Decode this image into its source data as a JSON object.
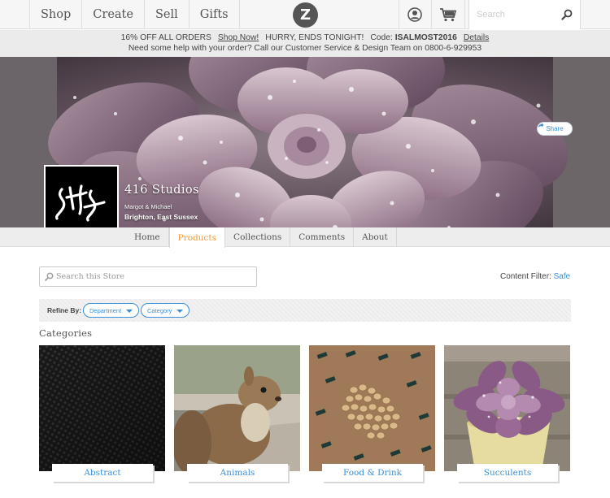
{
  "nav": {
    "items": [
      {
        "label": "Shop"
      },
      {
        "label": "Create"
      },
      {
        "label": "Sell"
      },
      {
        "label": "Gifts"
      }
    ],
    "logo_letter": "Z",
    "search_placeholder": "Search",
    "icons": {
      "user": "user-icon",
      "cart": "cart-icon",
      "search": "search-icon"
    }
  },
  "promo": {
    "line1_offer": "16% OFF ALL ORDERS",
    "line1_link": "Shop Now!",
    "line1_hurry": "HURRY, ENDS TONIGHT!",
    "line1_code_label": "Code:",
    "line1_code": "ISALMOST2016",
    "line1_details": "Details",
    "line2": "Need some help with your order? Call our Customer Service & Design Team on 0800-6-929953"
  },
  "store": {
    "share_label": "Share",
    "name": "416 Studios",
    "owner": "Margot & Michael",
    "location": "Brighton, East Sussex"
  },
  "tabs": [
    {
      "label": "Home",
      "active": false
    },
    {
      "label": "Products",
      "active": true
    },
    {
      "label": "Collections",
      "active": false
    },
    {
      "label": "Comments",
      "active": false
    },
    {
      "label": "About",
      "active": false
    }
  ],
  "store_search": {
    "placeholder": "Search this Store"
  },
  "content_filter": {
    "label": "Content Filter:",
    "value": "Safe"
  },
  "refine": {
    "label": "Refine By:",
    "department": "Department",
    "category": "Category"
  },
  "categories": {
    "heading": "Categories",
    "items": [
      {
        "label": "Abstract"
      },
      {
        "label": "Animals"
      },
      {
        "label": "Food & Drink"
      },
      {
        "label": "Succulents"
      }
    ]
  },
  "colors": {
    "accent": "#3a8fd8",
    "active_tab": "#f29a2e"
  }
}
